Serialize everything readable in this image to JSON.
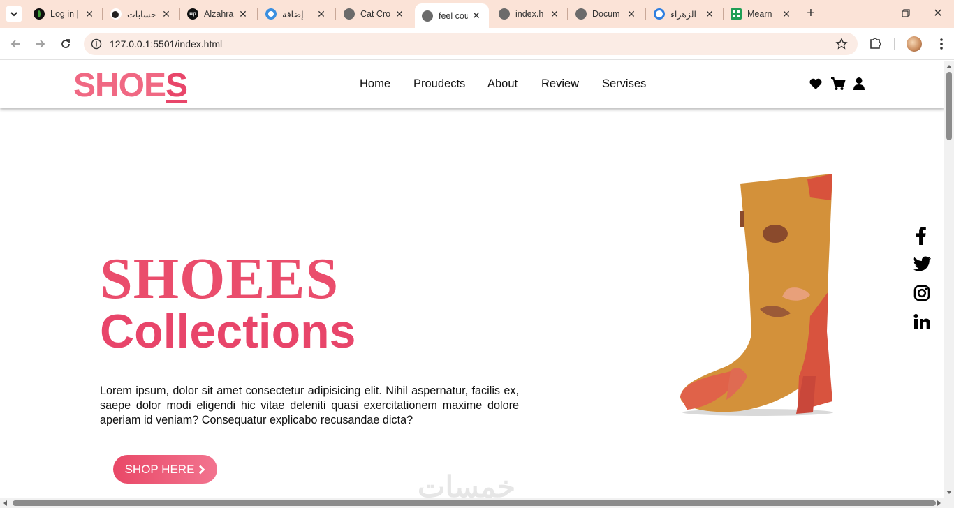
{
  "browser": {
    "tabs": [
      {
        "title": "Log in |"
      },
      {
        "title": "حسابات"
      },
      {
        "title": "Alzahra"
      },
      {
        "title": "إضافة"
      },
      {
        "title": "Cat Cro"
      },
      {
        "title": "feel cou"
      },
      {
        "title": "index.h"
      },
      {
        "title": "Docum"
      },
      {
        "title": "الزهراء"
      },
      {
        "title": "Mearn"
      }
    ],
    "url": "127.0.0.1:5501/index.html"
  },
  "site": {
    "logo_main": "SHOE",
    "logo_last": "S",
    "nav": [
      "Home",
      "Proudects",
      "About",
      "Review",
      "Servises"
    ],
    "hero": {
      "title": "SHOEES",
      "subtitle": "Collections",
      "description": "Lorem ipsum, dolor sit amet consectetur adipisicing elit. Nihil aspernatur, facilis ex, saepe dolor modi eligendi hic vitae deleniti quasi exercitationem maxime dolore aperiam id veniam? Consequatur explicabo recusandae dicta?",
      "button": "SHOP HERE"
    },
    "social": [
      "facebook-icon",
      "twitter-icon",
      "instagram-icon",
      "linkedin-icon"
    ],
    "watermark": "خمسات"
  },
  "colors": {
    "brand": "#ea4d6c",
    "tabbar": "#fbe3d7"
  }
}
